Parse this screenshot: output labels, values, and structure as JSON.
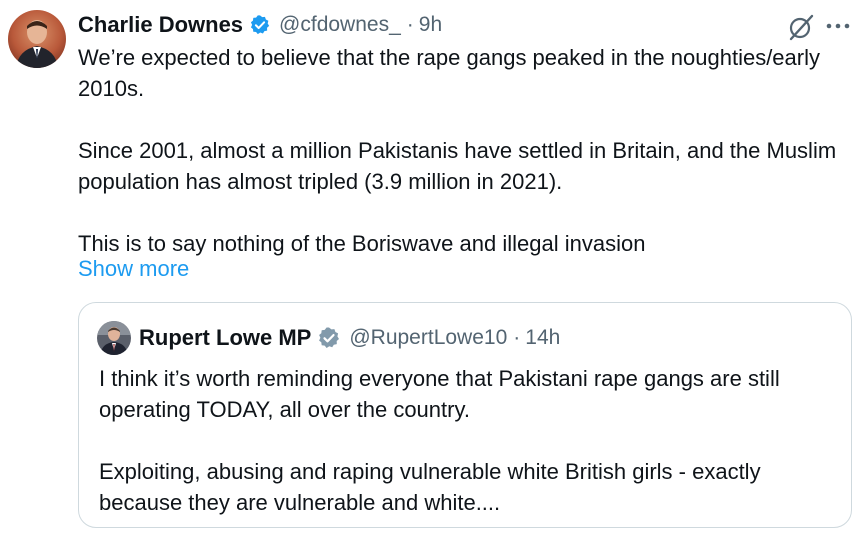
{
  "tweet": {
    "author": {
      "name": "Charlie Downes",
      "handle": "@cfdownes_",
      "separator": "·",
      "time": "9h"
    },
    "body": {
      "p1": "We’re expected to believe that the rape gangs peaked in the noughties/early 2010s.",
      "p2": "Since 2001, almost a million Pakistanis have settled in Britain, and the Muslim population has almost tripled (3.9 million in 2021).",
      "p3": "This is to say nothing of the Boriswave and illegal invasion"
    },
    "show_more": "Show more",
    "icons": {
      "grok": "grok-icon",
      "more": "more-icon",
      "verified": "verified-badge-icon"
    }
  },
  "quote": {
    "author": {
      "name": "Rupert Lowe MP",
      "handle": "@RupertLowe10",
      "separator": "·",
      "time": "14h"
    },
    "body": {
      "p1": "I think it’s worth reminding everyone that Pakistani rape gangs are still operating TODAY, all over the country.",
      "p2": "Exploiting, abusing and raping vulnerable white British girls - exactly because they are vulnerable and white...."
    }
  },
  "colors": {
    "text": "#0f1419",
    "secondary": "#536471",
    "link": "#1d9bf0",
    "verified_blue": "#1d9bf0",
    "verified_gray": "#829aab",
    "border": "#cfd9de"
  }
}
